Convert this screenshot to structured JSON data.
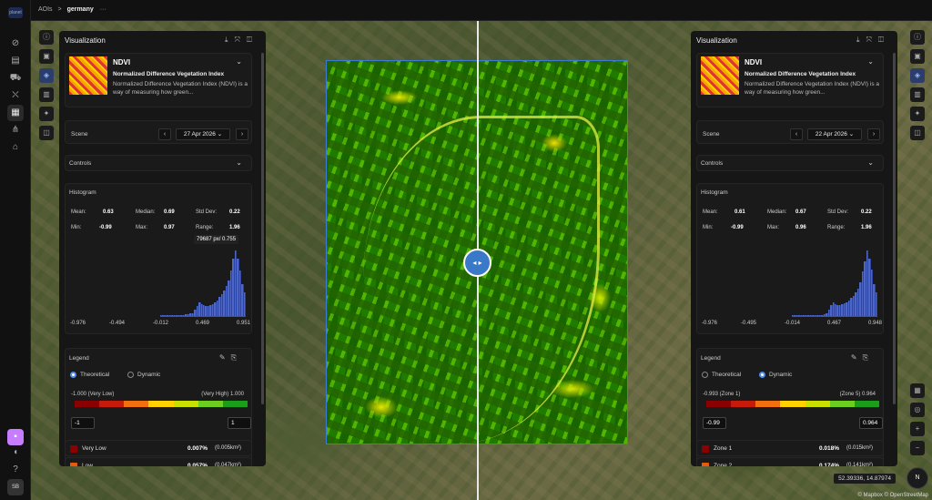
{
  "breadcrumb": {
    "root": "AOIs",
    "sep": ">",
    "current": "germany",
    "more": "···"
  },
  "app": {
    "logo_text": "planet",
    "user_initials": "SB"
  },
  "rail_icons": [
    "compass-icon",
    "inbox-icon",
    "car-icon",
    "cart-icon",
    "map-icon",
    "share-icon",
    "store-icon"
  ],
  "swiper_label": "◂ ▸",
  "left": {
    "title": "Visualization",
    "layer": {
      "name": "NDVI",
      "full": "Normalized Difference Vegetation Index",
      "desc": "Normalized Difference Vegetation Index (NDVI) is a way of measuring how green..."
    },
    "scene_label": "Scene",
    "date": "27 Apr 2026",
    "controls_label": "Controls",
    "histogram_label": "Histogram",
    "stats": {
      "mean_l": "Mean:",
      "mean": "0.63",
      "median_l": "Median:",
      "median": "0.69",
      "std_l": "Std Dev:",
      "std": "0.22",
      "min_l": "Min:",
      "min": "-0.99",
      "max_l": "Max:",
      "max": "0.97",
      "range_l": "Range:",
      "range": "1.96"
    },
    "tooltip": "79687 px/ 0.755",
    "ticks": [
      "-0.976",
      "-0.494",
      "-0.012",
      "0.469",
      "0.951"
    ],
    "hist": [
      1,
      1,
      1,
      1,
      1,
      1,
      1,
      1,
      1,
      1,
      1,
      2,
      2,
      3,
      3,
      6,
      10,
      14,
      12,
      11,
      10,
      10,
      11,
      12,
      14,
      16,
      19,
      22,
      26,
      30,
      36,
      46,
      58,
      66,
      58,
      46,
      32,
      24
    ],
    "legend_label": "Legend",
    "mode_theoretical": "Theoretical",
    "mode_dynamic": "Dynamic",
    "active_mode": "theoretical",
    "scale_low": "-1.000 (Very Low)",
    "scale_high": "(Very High) 1.000",
    "input_min": "-1",
    "input_max": "1",
    "rows": [
      {
        "name": "Very Low",
        "pct": "0.007%",
        "area": "(0.005km²)",
        "color": "#8b0000"
      },
      {
        "name": "Low",
        "pct": "0.057%",
        "area": "(0.047km²)",
        "color": "#e8590c"
      }
    ]
  },
  "right": {
    "title": "Visualization",
    "layer": {
      "name": "NDVI",
      "full": "Normalized Difference Vegetation Index",
      "desc": "Normalized Difference Vegetation Index (NDVI) is a way of measuring how green..."
    },
    "scene_label": "Scene",
    "date": "22 Apr 2026",
    "controls_label": "Controls",
    "histogram_label": "Histogram",
    "stats": {
      "mean_l": "Mean:",
      "mean": "0.61",
      "median_l": "Median:",
      "median": "0.67",
      "std_l": "Std Dev:",
      "std": "0.22",
      "min_l": "Min:",
      "min": "-0.99",
      "max_l": "Max:",
      "max": "0.96",
      "range_l": "Range:",
      "range": "1.96"
    },
    "ticks": [
      "-0.976",
      "-0.495",
      "-0.014",
      "0.467",
      "0.948"
    ],
    "hist": [
      1,
      1,
      1,
      1,
      1,
      1,
      1,
      1,
      1,
      1,
      1,
      1,
      1,
      1,
      2,
      3,
      6,
      10,
      13,
      11,
      10,
      10,
      11,
      12,
      13,
      15,
      17,
      19,
      22,
      26,
      32,
      42,
      52,
      62,
      54,
      44,
      30,
      22
    ],
    "legend_label": "Legend",
    "mode_theoretical": "Theoretical",
    "mode_dynamic": "Dynamic",
    "active_mode": "dynamic",
    "scale_low": "-0.993 (Zone 1)",
    "scale_high": "(Zone 5) 0.964",
    "input_min": "-0.99",
    "input_max": "0.964",
    "rows": [
      {
        "name": "Zone 1",
        "pct": "0.018%",
        "area": "(0.015km²)",
        "color": "#8b0000"
      },
      {
        "name": "Zone 2",
        "pct": "0.174%",
        "area": "(0.141km²)",
        "color": "#e8590c"
      }
    ]
  },
  "map": {
    "coords": "52.39336, 14.87974",
    "compass": "N",
    "attribution": "© Mapbox © OpenStreetMap"
  },
  "colors": {
    "grad": [
      "#8b0000",
      "#c61a0a",
      "#f07010",
      "#ffd200",
      "#c8e000",
      "#6ccf20",
      "#1a9e1a"
    ]
  }
}
